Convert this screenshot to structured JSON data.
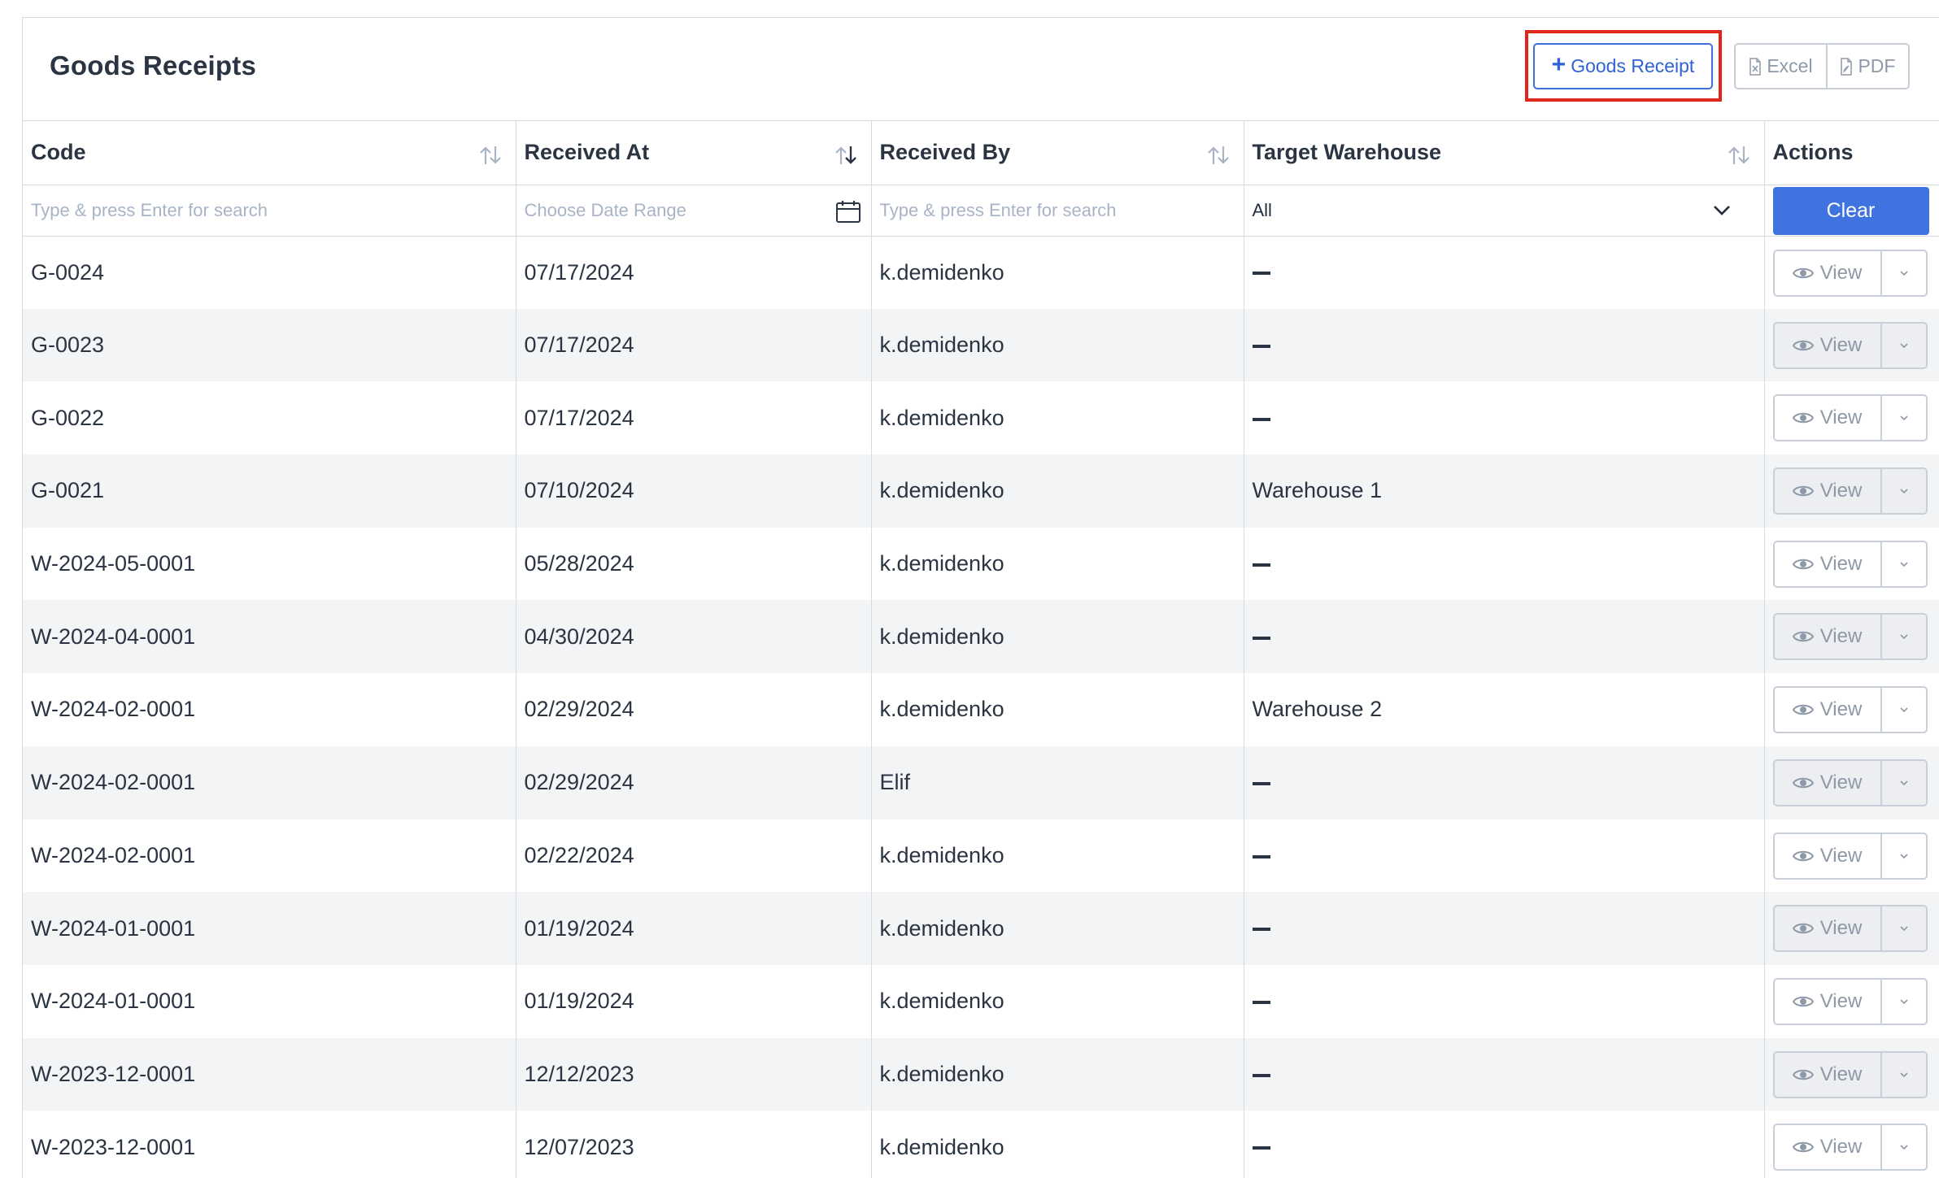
{
  "header": {
    "title": "Goods Receipts",
    "add_button_label": "Goods Receipt",
    "export": {
      "excel_label": "Excel",
      "pdf_label": "PDF"
    }
  },
  "table": {
    "columns": [
      {
        "label": "Code",
        "sortable": true
      },
      {
        "label": "Received At",
        "sortable": true,
        "sorted": "desc"
      },
      {
        "label": "Received By",
        "sortable": true
      },
      {
        "label": "Target Warehouse",
        "sortable": true
      },
      {
        "label": "Actions",
        "sortable": false
      }
    ],
    "filters": {
      "code_placeholder": "Type & press Enter for search",
      "date_placeholder": "Choose Date Range",
      "received_by_placeholder": "Type & press Enter for search",
      "warehouse_selected": "All",
      "clear_label": "Clear"
    },
    "view_label": "View",
    "rows": [
      {
        "code": "G-0024",
        "received_at": "07/17/2024",
        "received_by": "k.demidenko",
        "warehouse": ""
      },
      {
        "code": "G-0023",
        "received_at": "07/17/2024",
        "received_by": "k.demidenko",
        "warehouse": ""
      },
      {
        "code": "G-0022",
        "received_at": "07/17/2024",
        "received_by": "k.demidenko",
        "warehouse": ""
      },
      {
        "code": "G-0021",
        "received_at": "07/10/2024",
        "received_by": "k.demidenko",
        "warehouse": "Warehouse 1"
      },
      {
        "code": "W-2024-05-0001",
        "received_at": "05/28/2024",
        "received_by": "k.demidenko",
        "warehouse": ""
      },
      {
        "code": "W-2024-04-0001",
        "received_at": "04/30/2024",
        "received_by": "k.demidenko",
        "warehouse": ""
      },
      {
        "code": "W-2024-02-0001",
        "received_at": "02/29/2024",
        "received_by": "k.demidenko",
        "warehouse": "Warehouse 2"
      },
      {
        "code": "W-2024-02-0001",
        "received_at": "02/29/2024",
        "received_by": "Elif",
        "warehouse": ""
      },
      {
        "code": "W-2024-02-0001",
        "received_at": "02/22/2024",
        "received_by": "k.demidenko",
        "warehouse": ""
      },
      {
        "code": "W-2024-01-0001",
        "received_at": "01/19/2024",
        "received_by": "k.demidenko",
        "warehouse": ""
      },
      {
        "code": "W-2024-01-0001",
        "received_at": "01/19/2024",
        "received_by": "k.demidenko",
        "warehouse": ""
      },
      {
        "code": "W-2023-12-0001",
        "received_at": "12/12/2023",
        "received_by": "k.demidenko",
        "warehouse": ""
      },
      {
        "code": "W-2023-12-0001",
        "received_at": "12/07/2023",
        "received_by": "k.demidenko",
        "warehouse": ""
      }
    ]
  },
  "icons": {
    "add": "plus-icon",
    "excel": "file-excel-icon",
    "pdf": "file-pdf-icon",
    "sort": "sort-icon",
    "calendar": "calendar-icon",
    "select": "chevron-down-icon",
    "view": "eye-icon",
    "more": "caret-down-icon",
    "empty_value": "dash-icon"
  },
  "colors": {
    "primary": "#3f73e0",
    "highlight": "#e0261b",
    "muted": "#8e99a8",
    "placeholder": "#a8b4c6",
    "stripe": "#f3f4f6"
  }
}
